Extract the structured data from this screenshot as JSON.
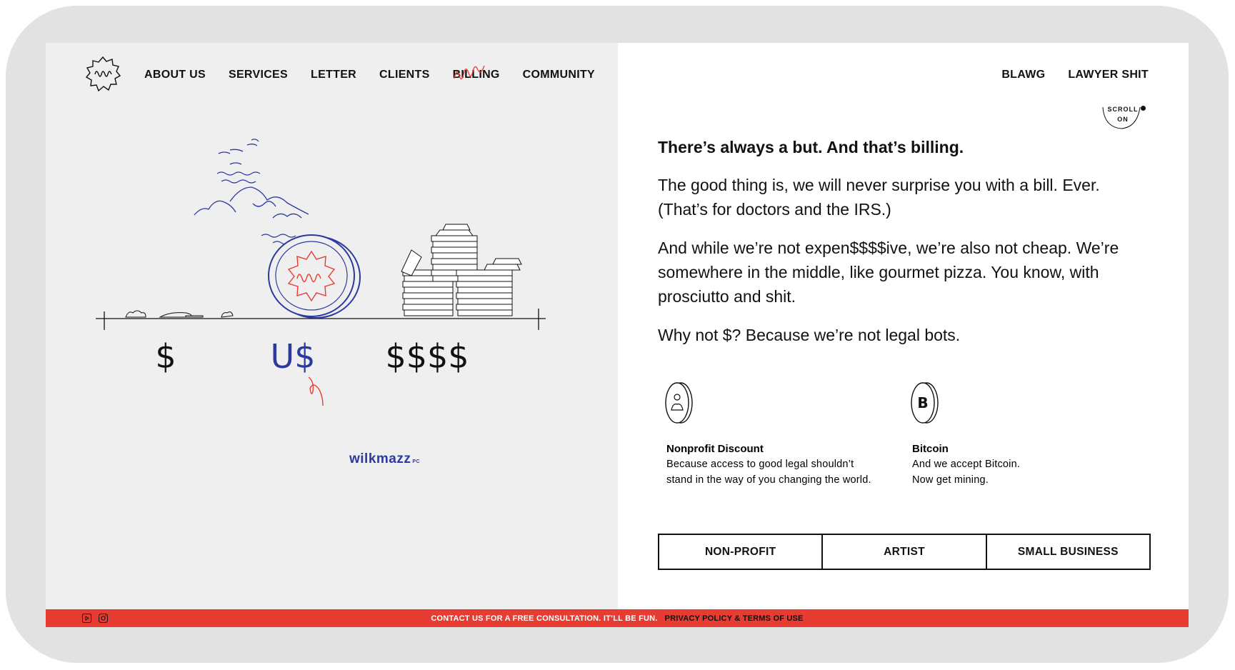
{
  "nav": {
    "left": [
      "ABOUT US",
      "SERVICES",
      "LETTER",
      "CLIENTS",
      "BILLING",
      "COMMUNITY"
    ],
    "active": "BILLING",
    "right": [
      "BLAWG",
      "LAWYER SHIT"
    ]
  },
  "scroll_badge": {
    "line1": "SCROLL",
    "line2": "ON"
  },
  "content": {
    "headline": "There’s always a but. And that’s billing.",
    "paragraphs": [
      "The good thing is, we will never surprise you with a bill. Ever. (That’s for doctors and the IRS.)",
      "And while we’re not expen$$$$ive, we’re also not cheap. We’re somewhere in the middle, like gourmet pizza. You know, with prosciutto and shit.",
      "Why not $? Because we’re not legal bots."
    ]
  },
  "features": [
    {
      "icon": "nonprofit-coin-icon",
      "title": "Nonprofit Discount",
      "desc_line1": "Because access to good legal shouldn’t",
      "desc_line2": "stand in the way of you changing the world."
    },
    {
      "icon": "bitcoin-coin-icon",
      "title": "Bitcoin",
      "desc_line1": "And we accept Bitcoin.",
      "desc_line2": "Now get mining."
    }
  ],
  "tabs": [
    "NON-PROFIT",
    "ARTIST",
    "SMALL BUSINESS"
  ],
  "illustration": {
    "labels": [
      "$",
      "U$",
      "$$$$"
    ],
    "brand": "wilkmazz",
    "brand_suffix": "PC"
  },
  "footer": {
    "cta": "CONTACT US FOR A FREE CONSULTATION. IT’LL BE FUN.",
    "link": "PRIVACY POLICY & TERMS OF USE",
    "icons": [
      "youtube-icon",
      "instagram-icon"
    ]
  },
  "colors": {
    "accent_red": "#e63c31",
    "brand_blue": "#2b3aa0",
    "panel_gray": "#efefef"
  }
}
